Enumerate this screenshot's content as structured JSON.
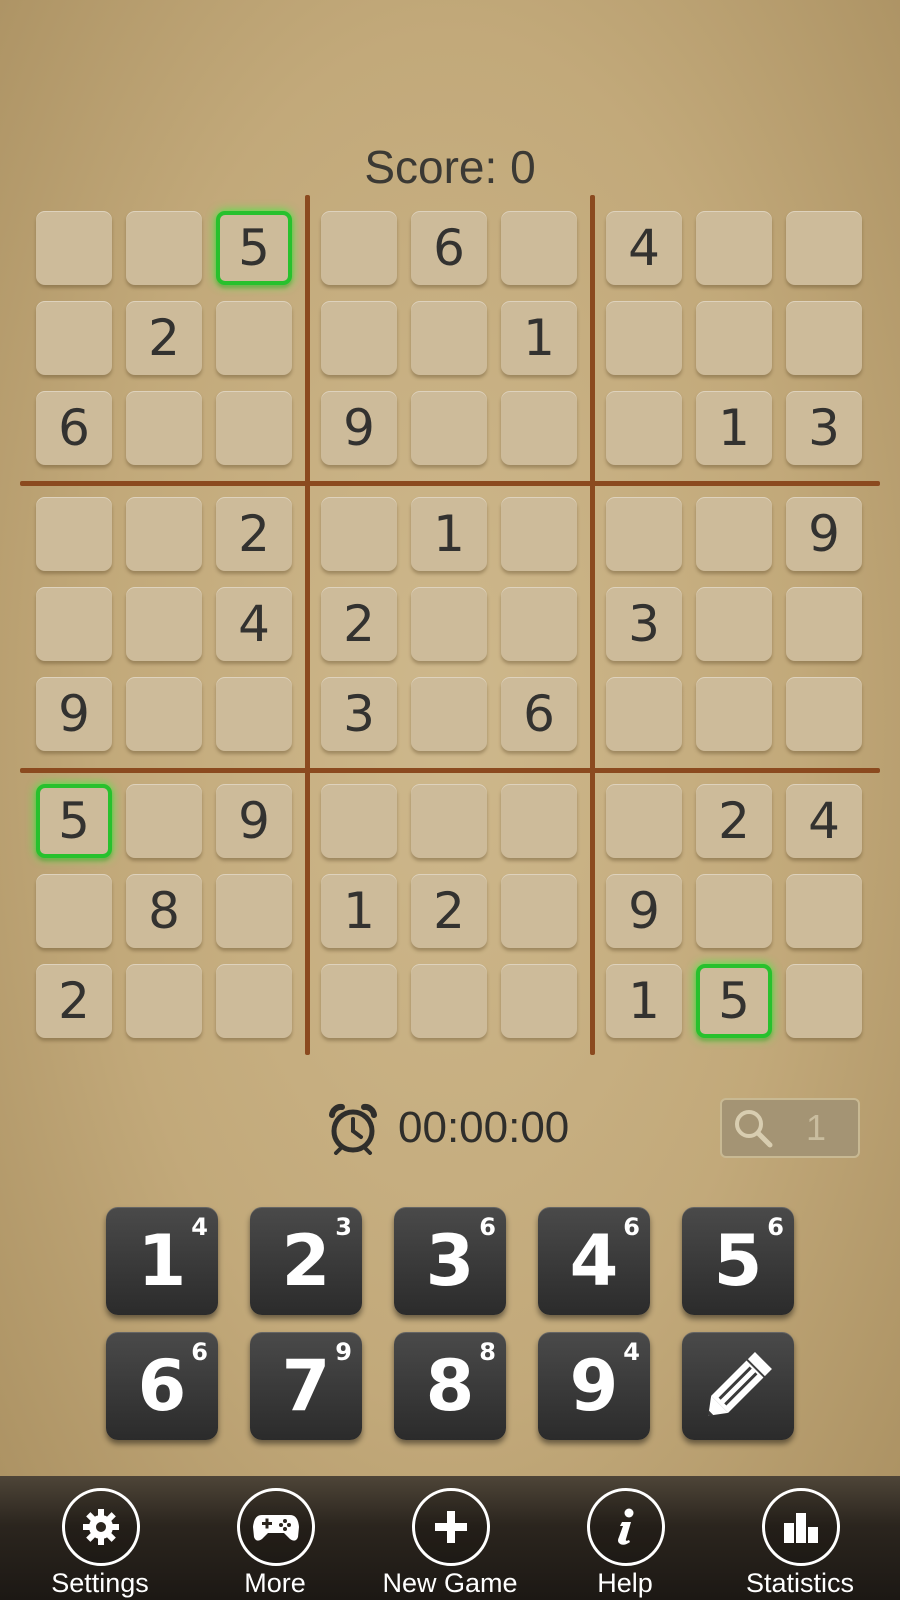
{
  "score_text": "Score: 0",
  "board": {
    "rows": [
      [
        "",
        "",
        "5",
        "",
        "6",
        "",
        "4",
        "",
        ""
      ],
      [
        "",
        "2",
        "",
        "",
        "",
        "1",
        "",
        "",
        ""
      ],
      [
        "6",
        "",
        "",
        "9",
        "",
        "",
        "",
        "1",
        "3"
      ],
      [
        "",
        "",
        "2",
        "",
        "1",
        "",
        "",
        "",
        "9"
      ],
      [
        "",
        "",
        "4",
        "2",
        "",
        "",
        "3",
        "",
        ""
      ],
      [
        "9",
        "",
        "",
        "3",
        "",
        "6",
        "",
        "",
        ""
      ],
      [
        "5",
        "",
        "9",
        "",
        "",
        "",
        "",
        "2",
        "4"
      ],
      [
        "",
        "8",
        "",
        "1",
        "2",
        "",
        "9",
        "",
        ""
      ],
      [
        "2",
        "",
        "",
        "",
        "",
        "",
        "1",
        "5",
        ""
      ]
    ],
    "highlighted_value": "5"
  },
  "timer": {
    "icon": "alarm-clock-icon",
    "text": "00:00:00"
  },
  "hint": {
    "icon": "magnifier-icon",
    "count": "1"
  },
  "keypad": {
    "keys": [
      {
        "num": "1",
        "count": "4"
      },
      {
        "num": "2",
        "count": "3"
      },
      {
        "num": "3",
        "count": "6"
      },
      {
        "num": "4",
        "count": "6"
      },
      {
        "num": "5",
        "count": "6"
      },
      {
        "num": "6",
        "count": "6"
      },
      {
        "num": "7",
        "count": "9"
      },
      {
        "num": "8",
        "count": "8"
      },
      {
        "num": "9",
        "count": "4"
      }
    ],
    "pencil_icon": "pencil-icon"
  },
  "nav": {
    "items": [
      {
        "label": "Settings",
        "icon": "gear-icon"
      },
      {
        "label": "More",
        "icon": "gamepad-icon"
      },
      {
        "label": "New Game",
        "icon": "plus-icon"
      },
      {
        "label": "Help",
        "icon": "info-icon"
      },
      {
        "label": "Statistics",
        "icon": "bar-chart-icon"
      }
    ]
  },
  "colors": {
    "highlight": "#27c12d",
    "grid_line": "#8b4a1f",
    "cell": "#cdbb9a",
    "key": "#333333"
  }
}
